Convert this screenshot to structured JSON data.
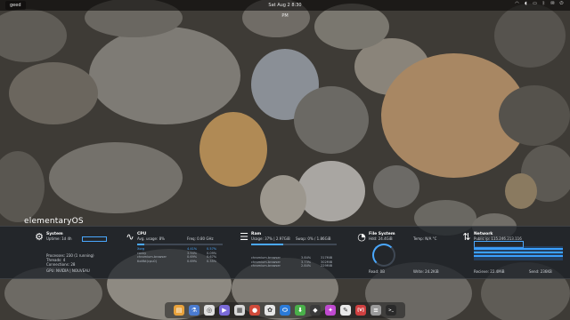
{
  "topbar": {
    "app_label": "geed",
    "clock": "Sat Aug 2 8:30 PM",
    "indicators": [
      "wifi-icon",
      "volume-icon",
      "battery-icon",
      "bluetooth-icon",
      "mail-icon",
      "power-icon"
    ]
  },
  "brand": "elementaryOS",
  "panels": {
    "system": {
      "title": "System",
      "uptime_label": "Uptime:",
      "uptime": "1d 4h",
      "icon": "gear-icon",
      "processes": "Processes: 230 (1 running)",
      "threads": "Threads: 4",
      "connections": "Connections: 28",
      "gpu": "GPU: NVIDIA | NOUVEAU"
    },
    "cpu": {
      "title": "CPU",
      "avg_load": "Avg. usage: 8%",
      "freq": "Freq: 0.80 GHz",
      "top_rows": [
        [
          "Xorg",
          "4.41%",
          "0.57%"
        ],
        [
          "conky",
          "3.94%",
          "0.09%"
        ],
        [
          "chromium-browser",
          "0.69%",
          "0.67%"
        ],
        [
          "tlotfbt(cpu0)",
          "0.69%",
          "0.35%"
        ]
      ],
      "icon": "cpu-icon",
      "bar_fill": 0.08
    },
    "ram": {
      "title": "Ram",
      "usage": "Usage: 37% | 2.97GiB",
      "swap": "Swap: 0% / 1.86GiB",
      "top_rows": [
        [
          "chromium-browser",
          "3.84%",
          "317MiB"
        ],
        [
          "chromium-browser",
          "3.73%",
          "302MiB"
        ],
        [
          "chromium-browser",
          "2.84%",
          "229MiB"
        ]
      ],
      "icon": "memory-icon",
      "bar_fill": 0.37
    },
    "filesystem": {
      "title": "File System",
      "hdd": "Hdd: 24.4GiB",
      "temp": "Temp: N/A °C",
      "read": "Read: 0B",
      "write": "Write: 24.2KiB",
      "icon": "disk-icon",
      "fill": 0.35
    },
    "network": {
      "title": "Network",
      "public_ip": "Public ip: 115.246.213.116",
      "receive": "Recieve: 22.4MiB",
      "send": "Send: 236KB",
      "icon": "network-icon"
    }
  },
  "dock": {
    "apps": [
      {
        "name": "files",
        "color": "#e8a23c",
        "glyph": "▤"
      },
      {
        "name": "lab",
        "color": "#4a7bd0",
        "glyph": "⚗"
      },
      {
        "name": "chrome",
        "color": "#e0e0e0",
        "glyph": "◎"
      },
      {
        "name": "media",
        "color": "#7a6ad8",
        "glyph": "▶"
      },
      {
        "name": "calendar",
        "color": "#d9d9d9",
        "glyph": "▦"
      },
      {
        "name": "terminal-red",
        "color": "#d04a3a",
        "glyph": "●"
      },
      {
        "name": "photos",
        "color": "#e6e6e6",
        "glyph": "✿"
      },
      {
        "name": "toggle",
        "color": "#2a7ad8",
        "glyph": "⬭"
      },
      {
        "name": "download",
        "color": "#4ab04a",
        "glyph": "⬇"
      },
      {
        "name": "app-store",
        "color": "#3a3a3a",
        "glyph": "◆"
      },
      {
        "name": "appcenter",
        "color": "#c04ad0",
        "glyph": "✦"
      },
      {
        "name": "chat",
        "color": "#e8e8e8",
        "glyph": "✎"
      },
      {
        "name": "vim",
        "color": "#d04040",
        "glyph": "[V]"
      },
      {
        "name": "settings",
        "color": "#9a9a9a",
        "glyph": "≡"
      },
      {
        "name": "console",
        "color": "#2a2a2a",
        "glyph": ">_"
      }
    ]
  }
}
